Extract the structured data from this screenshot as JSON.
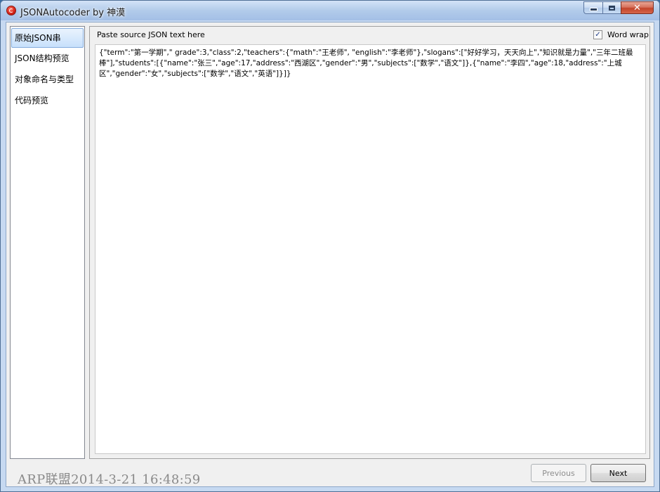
{
  "window": {
    "title": "JSONAutocoder by 神漠"
  },
  "caption_buttons": {
    "close_glyph": "✕"
  },
  "nav": {
    "items": [
      {
        "label": "原始JSON串",
        "selected": true
      },
      {
        "label": "JSON结构预览",
        "selected": false
      },
      {
        "label": "对象命名与类型",
        "selected": false
      },
      {
        "label": "代码预览",
        "selected": false
      }
    ]
  },
  "editor": {
    "instruction": "Paste source JSON text here",
    "word_wrap_label": "Word wrap",
    "word_wrap_checked": true,
    "check_glyph": "✓",
    "json_text": "{\"term\":\"第一学期\",\" grade\":3,\"class\":2,\"teachers\":{\"math\":\"王老师\", \"english\":\"李老师\"},\"slogans\":[\"好好学习，天天向上\",\"知识就是力量\",\"三年二班最棒\"],\"students\":[{\"name\":\"张三\",\"age\":17,\"address\":\"西湖区\",\"gender\":\"男\",\"subjects\":[\"数学\",\"语文\"]},{\"name\":\"李四\",\"age\":18,\"address\":\"上城区\",\"gender\":\"女\",\"subjects\":[\"数学\",\"语文\",\"英语\"]}]}"
  },
  "footer": {
    "watermark": "ARP联盟2014-3-21 16:48:59",
    "previous_label": "Previous",
    "previous_enabled": false,
    "next_label": "Next"
  },
  "colors": {
    "title_bar": "#b2cbea",
    "selected_item": "#c7e0fb",
    "close_button": "#c2442a"
  }
}
